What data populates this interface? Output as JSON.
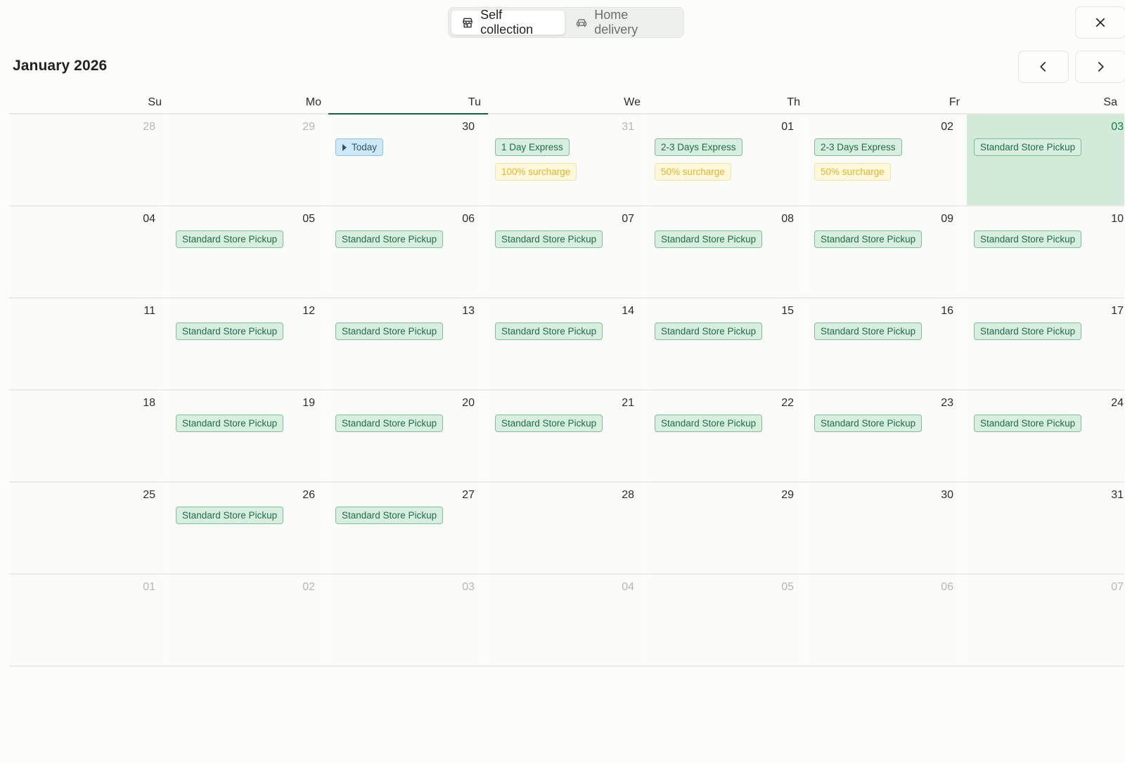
{
  "mode_switch": {
    "options": [
      {
        "label": "Self collection",
        "icon": "store-icon",
        "active": true
      },
      {
        "label": "Home delivery",
        "icon": "car-icon",
        "active": false
      }
    ]
  },
  "header": {
    "title": "January 2026"
  },
  "weekdays": [
    "Su",
    "Mo",
    "Tu",
    "We",
    "Th",
    "Fr",
    "Sa"
  ],
  "today_weekday_index": 2,
  "colors": {
    "accent": "#1b5e3d",
    "selected_bg": "#d2ebd9",
    "tag_green": "#d8efdf",
    "tag_yellow": "#fdf7dc",
    "tag_today": "#cfe8f7"
  },
  "weeks": [
    [
      {
        "day": "28",
        "state": "muted",
        "tags": []
      },
      {
        "day": "29",
        "state": "muted",
        "tags": []
      },
      {
        "day": "30",
        "state": "today",
        "tags": [
          {
            "label": "Today",
            "kind": "today"
          }
        ]
      },
      {
        "day": "31",
        "state": "muted",
        "tags": [
          {
            "label": "1 Day Express",
            "kind": "green"
          },
          {
            "label": "100% surcharge",
            "kind": "yellow"
          }
        ]
      },
      {
        "day": "01",
        "state": "normal",
        "tags": [
          {
            "label": "2-3 Days Express",
            "kind": "green"
          },
          {
            "label": "50% surcharge",
            "kind": "yellow"
          }
        ]
      },
      {
        "day": "02",
        "state": "normal",
        "tags": [
          {
            "label": "2-3 Days Express",
            "kind": "green"
          },
          {
            "label": "50% surcharge",
            "kind": "yellow"
          }
        ]
      },
      {
        "day": "03",
        "state": "selected",
        "tags": [
          {
            "label": "Standard Store Pickup",
            "kind": "green"
          }
        ]
      }
    ],
    [
      {
        "day": "04",
        "state": "normal",
        "tags": []
      },
      {
        "day": "05",
        "state": "normal",
        "tags": [
          {
            "label": "Standard Store Pickup",
            "kind": "green"
          }
        ]
      },
      {
        "day": "06",
        "state": "normal",
        "tags": [
          {
            "label": "Standard Store Pickup",
            "kind": "green"
          }
        ]
      },
      {
        "day": "07",
        "state": "normal",
        "tags": [
          {
            "label": "Standard Store Pickup",
            "kind": "green"
          }
        ]
      },
      {
        "day": "08",
        "state": "normal",
        "tags": [
          {
            "label": "Standard Store Pickup",
            "kind": "green"
          }
        ]
      },
      {
        "day": "09",
        "state": "normal",
        "tags": [
          {
            "label": "Standard Store Pickup",
            "kind": "green"
          }
        ]
      },
      {
        "day": "10",
        "state": "normal",
        "tags": [
          {
            "label": "Standard Store Pickup",
            "kind": "green"
          }
        ]
      }
    ],
    [
      {
        "day": "11",
        "state": "normal",
        "tags": []
      },
      {
        "day": "12",
        "state": "normal",
        "tags": [
          {
            "label": "Standard Store Pickup",
            "kind": "green"
          }
        ]
      },
      {
        "day": "13",
        "state": "normal",
        "tags": [
          {
            "label": "Standard Store Pickup",
            "kind": "green"
          }
        ]
      },
      {
        "day": "14",
        "state": "normal",
        "tags": [
          {
            "label": "Standard Store Pickup",
            "kind": "green"
          }
        ]
      },
      {
        "day": "15",
        "state": "normal",
        "tags": [
          {
            "label": "Standard Store Pickup",
            "kind": "green"
          }
        ]
      },
      {
        "day": "16",
        "state": "normal",
        "tags": [
          {
            "label": "Standard Store Pickup",
            "kind": "green"
          }
        ]
      },
      {
        "day": "17",
        "state": "normal",
        "tags": [
          {
            "label": "Standard Store Pickup",
            "kind": "green"
          }
        ]
      }
    ],
    [
      {
        "day": "18",
        "state": "normal",
        "tags": []
      },
      {
        "day": "19",
        "state": "normal",
        "tags": [
          {
            "label": "Standard Store Pickup",
            "kind": "green"
          }
        ]
      },
      {
        "day": "20",
        "state": "normal",
        "tags": [
          {
            "label": "Standard Store Pickup",
            "kind": "green"
          }
        ]
      },
      {
        "day": "21",
        "state": "normal",
        "tags": [
          {
            "label": "Standard Store Pickup",
            "kind": "green"
          }
        ]
      },
      {
        "day": "22",
        "state": "normal",
        "tags": [
          {
            "label": "Standard Store Pickup",
            "kind": "green"
          }
        ]
      },
      {
        "day": "23",
        "state": "normal",
        "tags": [
          {
            "label": "Standard Store Pickup",
            "kind": "green"
          }
        ]
      },
      {
        "day": "24",
        "state": "normal",
        "tags": [
          {
            "label": "Standard Store Pickup",
            "kind": "green"
          }
        ]
      }
    ],
    [
      {
        "day": "25",
        "state": "normal",
        "tags": []
      },
      {
        "day": "26",
        "state": "normal",
        "tags": [
          {
            "label": "Standard Store Pickup",
            "kind": "green"
          }
        ]
      },
      {
        "day": "27",
        "state": "normal",
        "tags": [
          {
            "label": "Standard Store Pickup",
            "kind": "green"
          }
        ]
      },
      {
        "day": "28",
        "state": "normal",
        "tags": []
      },
      {
        "day": "29",
        "state": "normal",
        "tags": []
      },
      {
        "day": "30",
        "state": "normal",
        "tags": []
      },
      {
        "day": "31",
        "state": "normal",
        "tags": []
      }
    ],
    [
      {
        "day": "01",
        "state": "muted",
        "tags": []
      },
      {
        "day": "02",
        "state": "muted",
        "tags": []
      },
      {
        "day": "03",
        "state": "muted",
        "tags": []
      },
      {
        "day": "04",
        "state": "muted",
        "tags": []
      },
      {
        "day": "05",
        "state": "muted",
        "tags": []
      },
      {
        "day": "06",
        "state": "muted",
        "tags": []
      },
      {
        "day": "07",
        "state": "muted",
        "tags": []
      }
    ]
  ]
}
